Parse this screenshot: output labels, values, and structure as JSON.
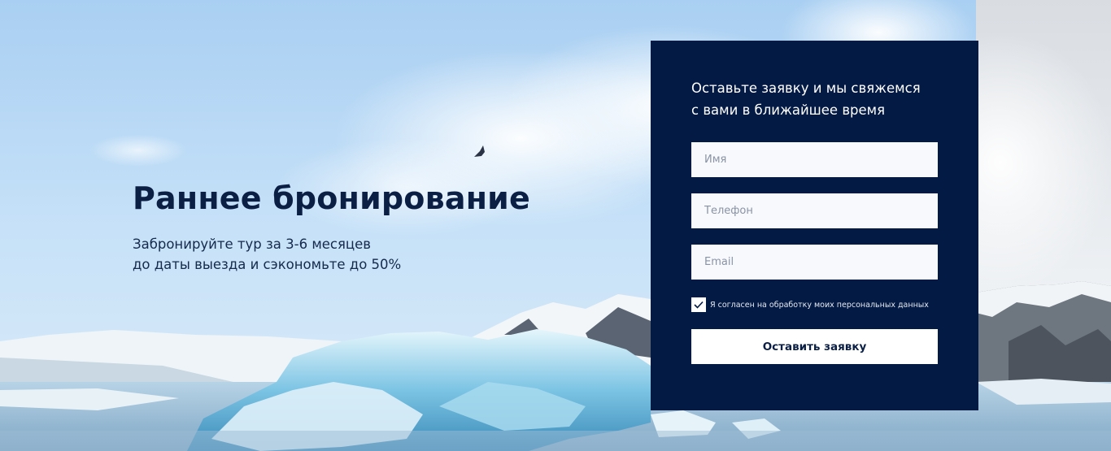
{
  "hero": {
    "title": "Раннее бронирование",
    "subtitle_line1": "Забронируйте тур за 3-6 месяцев",
    "subtitle_line2": "до даты выезда и сэкономьте до 50%"
  },
  "form": {
    "heading_line1": "Оставьте заявку и мы свяжемся",
    "heading_line2": "с вами в ближайшее время",
    "name_placeholder": "Имя",
    "phone_placeholder": "Телефон",
    "email_placeholder": "Email",
    "name_value": "",
    "phone_value": "",
    "email_value": "",
    "consent_checked": true,
    "consent_label": "Я согласен на обработку моих персональных данных",
    "submit_label": "Оставить заявку"
  },
  "colors": {
    "panel_bg": "#031a44",
    "title": "#0b1f45",
    "field_bg": "#f7f9fc",
    "button_bg": "#ffffff"
  },
  "icons": {
    "checkbox": "check-icon"
  }
}
